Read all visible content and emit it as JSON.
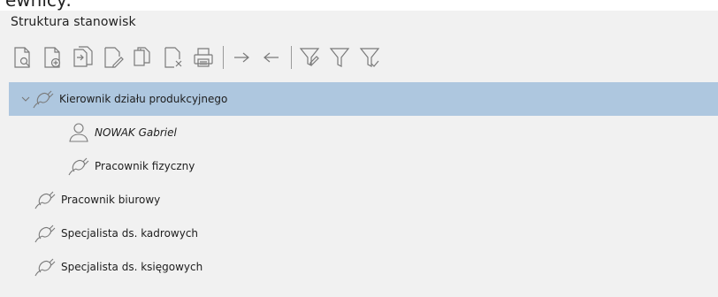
{
  "panel": {
    "title": "Struktura stanowisk"
  },
  "toolbar": {
    "buttons": [
      {
        "icon": "preview-document-icon"
      },
      {
        "icon": "add-document-icon"
      },
      {
        "icon": "copy-document-icon"
      },
      {
        "icon": "edit-document-icon"
      },
      {
        "icon": "duplicate-document-icon"
      },
      {
        "icon": "delete-document-icon"
      },
      {
        "icon": "print-icon"
      },
      {
        "icon": "arrow-right-icon"
      },
      {
        "icon": "arrow-left-icon"
      },
      {
        "icon": "filter-edit-icon"
      },
      {
        "icon": "filter-icon"
      },
      {
        "icon": "filter-check-icon"
      }
    ]
  },
  "tree": {
    "nodes": [
      {
        "label": "Kierownik działu produkcyjnego",
        "icon": "position-plug-icon",
        "level": 0,
        "expanded": true,
        "selected": true
      },
      {
        "label": "NOWAK Gabriel",
        "icon": "person-icon",
        "level": 1,
        "italic": true
      },
      {
        "label": "Pracownik fizyczny",
        "icon": "position-plug-icon",
        "level": 1
      },
      {
        "label": "Pracownik biurowy",
        "icon": "position-plug-icon",
        "level": 0
      },
      {
        "label": "Specjalista ds. kadrowych",
        "icon": "position-plug-icon",
        "level": 0
      },
      {
        "label": "Specjalista ds. księgowych",
        "icon": "position-plug-icon",
        "level": 0
      }
    ]
  },
  "colors": {
    "selection": "#aec7df",
    "background": "#f1f1f1",
    "icon_stroke": "#7a7a7a"
  }
}
